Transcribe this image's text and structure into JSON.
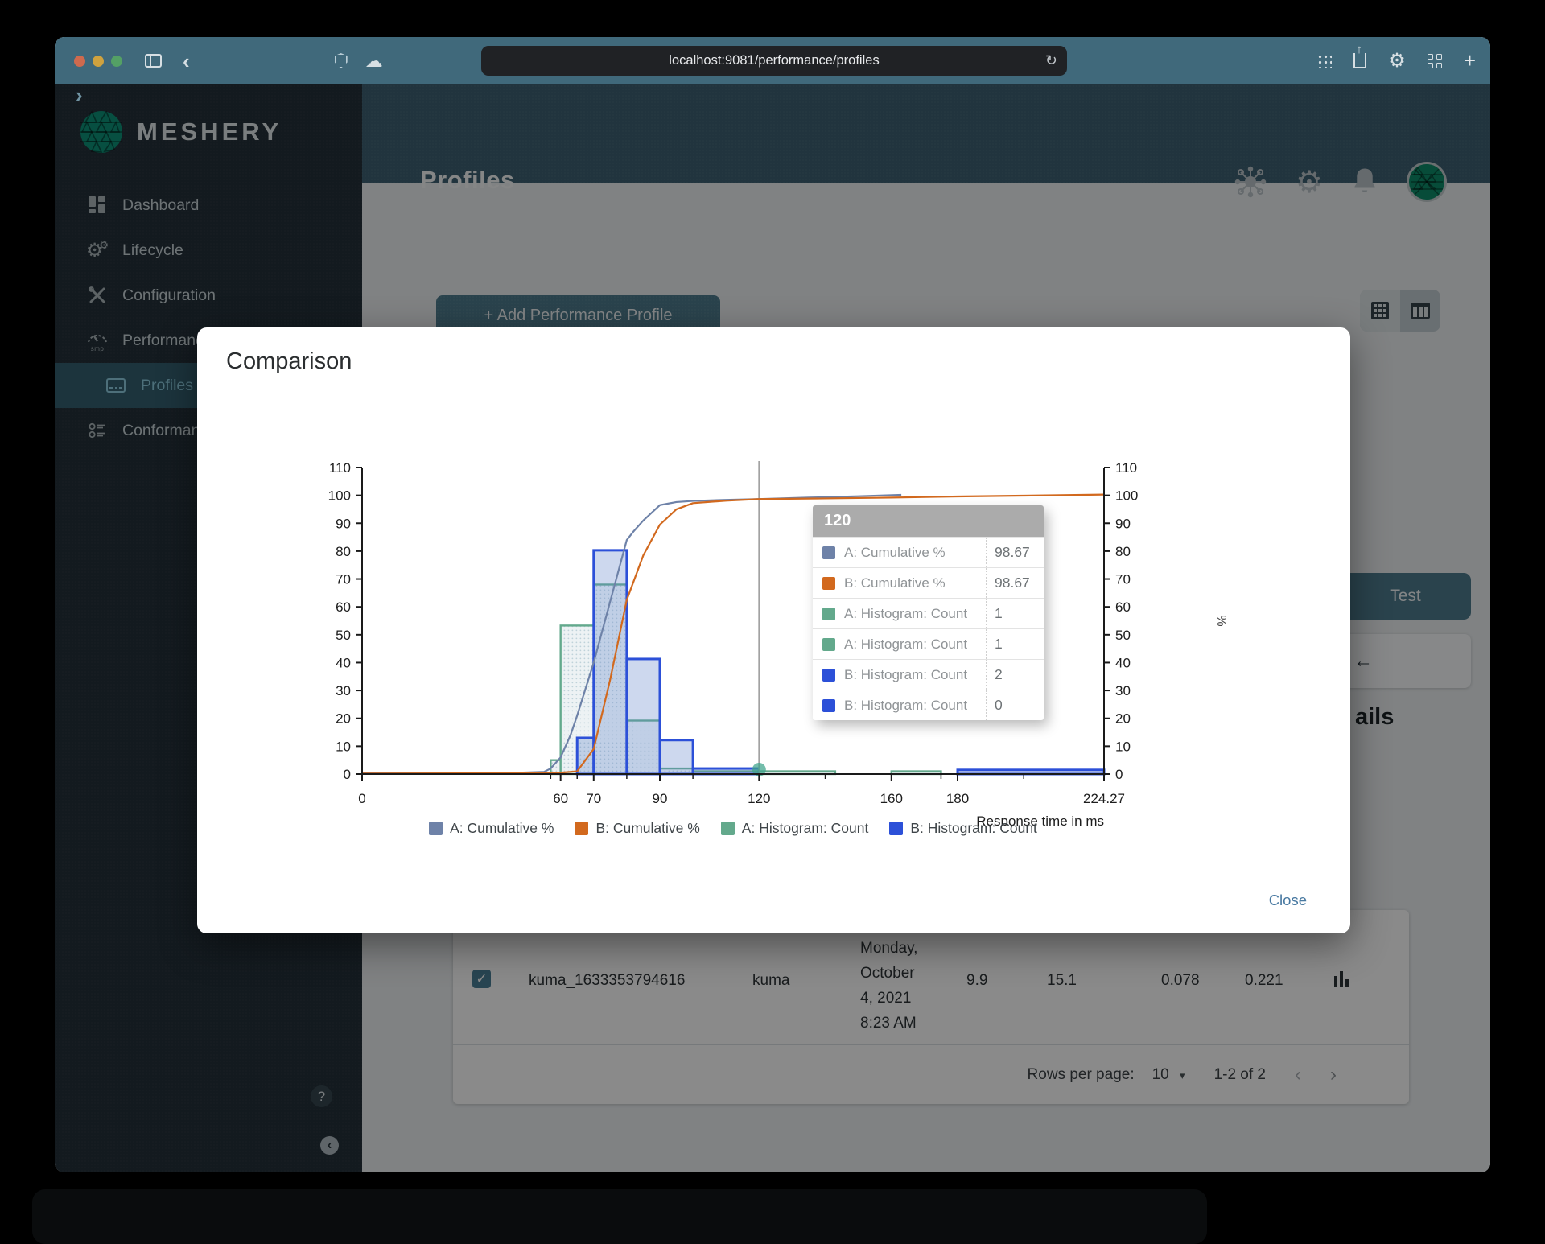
{
  "browser": {
    "url": "localhost:9081/performance/profiles",
    "icons": {
      "back": "‹",
      "forward": "›",
      "reload": "↻",
      "cloud": "☁",
      "plus": "+"
    }
  },
  "header": {
    "title": "Profiles"
  },
  "sidebar": {
    "brand": "MESHERY",
    "items": [
      {
        "label": "Dashboard"
      },
      {
        "label": "Lifecycle"
      },
      {
        "label": "Configuration"
      },
      {
        "label": "Performance"
      },
      {
        "label": "Profiles"
      },
      {
        "label": "Conformance"
      }
    ]
  },
  "content": {
    "plus": "+",
    "add_button_label": "Add Performance Profile",
    "test_button": "Test",
    "arrow": "←",
    "details_fragment": "ails",
    "table": {
      "row": {
        "checked": "✓",
        "name": "kuma_1633353794616",
        "mesh": "kuma",
        "date": [
          "Monday,",
          "October",
          "4, 2021",
          "8:23 AM"
        ],
        "v1": "9.9",
        "v2": "15.1",
        "v3": "0.078",
        "v4": "0.221"
      }
    },
    "pagination": {
      "rows_label": "Rows per page:",
      "per_page": "10",
      "caret": "▾",
      "range": "1-2 of 2",
      "prev": "‹",
      "next": "›"
    }
  },
  "fabs": {
    "help": "?",
    "collapse": "‹"
  },
  "modal": {
    "title": "Comparison",
    "close": "Close",
    "tooltip": {
      "header": "120",
      "rows": [
        {
          "label": "A: Cumulative %",
          "value": "98.67",
          "color": "#6e82a8",
          "pattern": false
        },
        {
          "label": "B: Cumulative %",
          "value": "98.67",
          "color": "#d2691e",
          "pattern": false
        },
        {
          "label": "A: Histogram: Count",
          "value": "1",
          "color": "#63a98c",
          "pattern": true
        },
        {
          "label": "A: Histogram: Count",
          "value": "1",
          "color": "#63a98c",
          "pattern": true
        },
        {
          "label": "B: Histogram: Count",
          "value": "2",
          "color": "#2c50d8",
          "pattern": true
        },
        {
          "label": "B: Histogram: Count",
          "value": "0",
          "color": "#2c50d8",
          "pattern": true
        }
      ]
    }
  },
  "chart_data": {
    "type": "combo-histogram-cumulative",
    "title": "",
    "xlabel": "Response time in ms",
    "right_axis_label": "%",
    "xlim": [
      0,
      224.27
    ],
    "ylim": [
      0,
      110
    ],
    "y_tick_step": 10,
    "x_major_ticks": [
      0,
      60,
      70,
      90,
      120,
      160,
      180,
      224.27
    ],
    "x_minor_ticks": [
      57,
      65,
      80,
      100,
      140,
      175,
      200
    ],
    "grid": false,
    "legend_position": "bottom",
    "series": [
      {
        "name": "A: Cumulative %",
        "type": "line",
        "color": "#6e82a8",
        "points": [
          [
            0,
            0.3
          ],
          [
            45,
            0.4
          ],
          [
            55,
            0.8
          ],
          [
            57,
            2
          ],
          [
            60,
            6
          ],
          [
            63,
            14
          ],
          [
            65,
            21
          ],
          [
            70,
            40
          ],
          [
            75,
            62
          ],
          [
            80,
            84
          ],
          [
            82,
            87
          ],
          [
            85,
            91
          ],
          [
            90,
            96.5
          ],
          [
            95,
            97.6
          ],
          [
            100,
            98
          ],
          [
            110,
            98.4
          ],
          [
            120,
            98.67
          ],
          [
            135,
            99.2
          ],
          [
            150,
            99.7
          ],
          [
            163,
            100.2
          ]
        ]
      },
      {
        "name": "B: Cumulative %",
        "type": "line",
        "color": "#d2691e",
        "points": [
          [
            0,
            0.2
          ],
          [
            50,
            0.3
          ],
          [
            60,
            0.5
          ],
          [
            65,
            1
          ],
          [
            70,
            9
          ],
          [
            75,
            34
          ],
          [
            80,
            62.5
          ],
          [
            85,
            78.5
          ],
          [
            90,
            89.5
          ],
          [
            95,
            95
          ],
          [
            100,
            97.2
          ],
          [
            110,
            98.1
          ],
          [
            120,
            98.67
          ],
          [
            140,
            98.9
          ],
          [
            160,
            99.2
          ],
          [
            180,
            99.6
          ],
          [
            200,
            99.9
          ],
          [
            224.27,
            100.3
          ]
        ]
      },
      {
        "name": "A: Histogram: Count",
        "type": "histogram",
        "color": "#63a98c",
        "fill": "pattern",
        "bars": [
          [
            57,
            60,
            5
          ],
          [
            60,
            70,
            53.3
          ],
          [
            70,
            80,
            68
          ],
          [
            80,
            90,
            19.2
          ],
          [
            90,
            100,
            2
          ],
          [
            100,
            143,
            1
          ],
          [
            160,
            175,
            1
          ]
        ]
      },
      {
        "name": "B: Histogram: Count",
        "type": "histogram",
        "color": "#2c50d8",
        "fill": "rgba(90,125,200,0.30)",
        "bars": [
          [
            65,
            70,
            13
          ],
          [
            70,
            80,
            80.3
          ],
          [
            80,
            90,
            41.3
          ],
          [
            90,
            100,
            12.2
          ],
          [
            100,
            120,
            2
          ],
          [
            180,
            224.27,
            1.5
          ]
        ]
      }
    ],
    "crosshair_x": 120,
    "hover_dot": {
      "x": 120,
      "y": 1.6,
      "color": "#3ea38a"
    },
    "legend": [
      {
        "label": "A: Cumulative %",
        "color": "#6e82a8",
        "pattern": false
      },
      {
        "label": "B: Cumulative %",
        "color": "#d2691e",
        "pattern": false
      },
      {
        "label": "A: Histogram: Count",
        "color": "#63a98c",
        "pattern": true
      },
      {
        "label": "B: Histogram: Count",
        "color": "#2c50d8",
        "pattern": false
      }
    ]
  },
  "colors": {
    "brand_green": "#00b39f",
    "header": "#3d6071",
    "chrome": "#40697b",
    "accent": "#4e7a8c"
  }
}
